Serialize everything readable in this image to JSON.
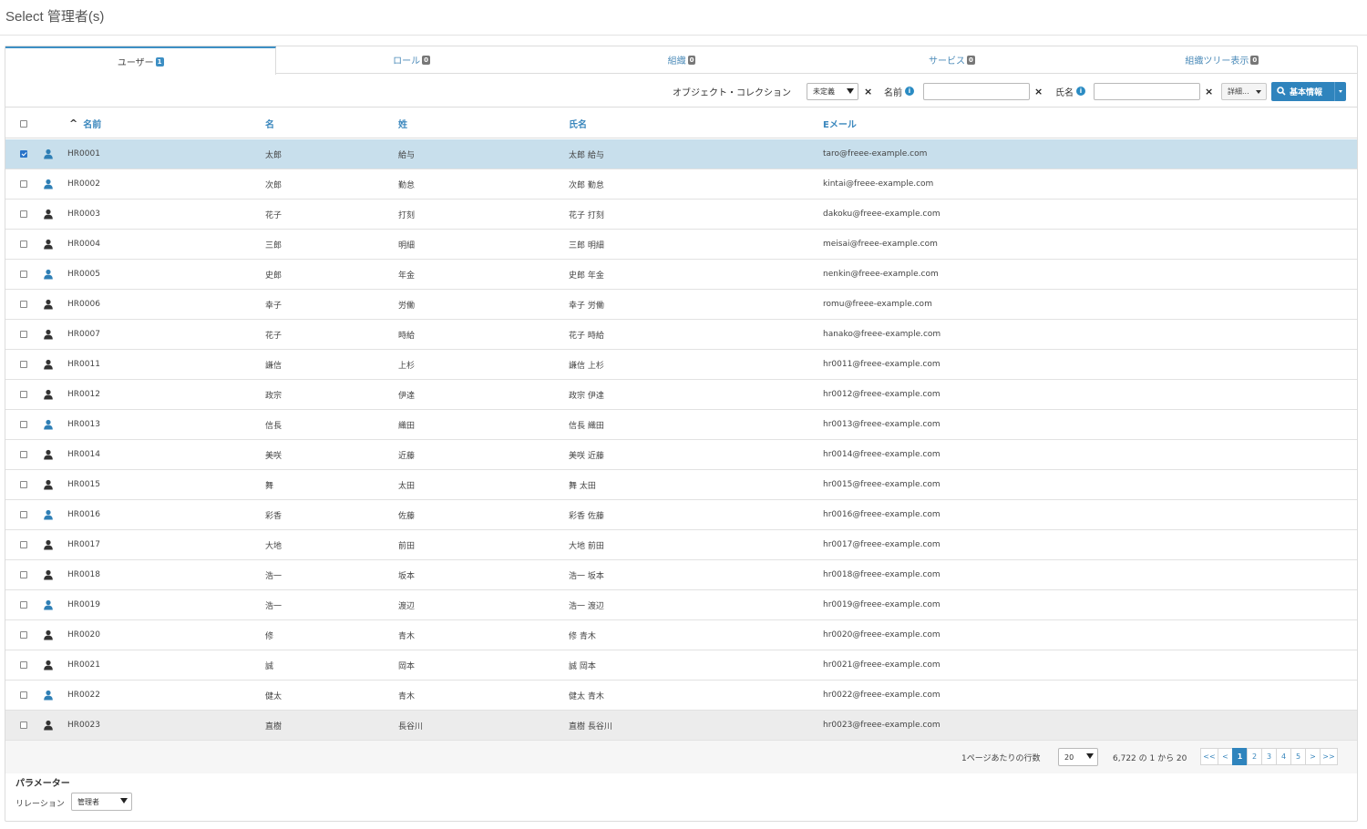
{
  "title": "Select 管理者(s)",
  "tabs": [
    {
      "label": "ユーザー",
      "badge": "1"
    },
    {
      "label": "ロール",
      "badge": "0"
    },
    {
      "label": "組織",
      "badge": "0"
    },
    {
      "label": "サービス",
      "badge": "0"
    },
    {
      "label": "組織ツリー表示",
      "badge": "0"
    }
  ],
  "filters": {
    "object_collection_label": "オブジェクト・コレクション",
    "object_collection_value": "未定義",
    "name_label": "名前",
    "name_value": "",
    "fullname_label": "氏名",
    "fullname_value": "",
    "clear_glyph": "×",
    "info_glyph": "i",
    "detail_button": "詳細...",
    "search_button": "基本情報"
  },
  "columns": {
    "sort_glyph": "^",
    "name": "名前",
    "first_name": "名",
    "last_name": "姓",
    "full_name": "氏名",
    "email": "Eメール"
  },
  "rows": [
    {
      "id": "HR0001",
      "first": "太郎",
      "last": "給与",
      "full": "太郎 給与",
      "email": "taro@freee-example.com",
      "checked": true,
      "icon_color": "#2f7fb5"
    },
    {
      "id": "HR0002",
      "first": "次郎",
      "last": "勤怠",
      "full": "次郎 勤怠",
      "email": "kintai@freee-example.com",
      "checked": false,
      "icon_color": "#2f7fb5"
    },
    {
      "id": "HR0003",
      "first": "花子",
      "last": "打刻",
      "full": "花子 打刻",
      "email": "dakoku@freee-example.com",
      "checked": false,
      "icon_color": "#333333"
    },
    {
      "id": "HR0004",
      "first": "三郎",
      "last": "明細",
      "full": "三郎 明細",
      "email": "meisai@freee-example.com",
      "checked": false,
      "icon_color": "#333333"
    },
    {
      "id": "HR0005",
      "first": "史郎",
      "last": "年金",
      "full": "史郎 年金",
      "email": "nenkin@freee-example.com",
      "checked": false,
      "icon_color": "#2f7fb5"
    },
    {
      "id": "HR0006",
      "first": "幸子",
      "last": "労働",
      "full": "幸子 労働",
      "email": "romu@freee-example.com",
      "checked": false,
      "icon_color": "#333333"
    },
    {
      "id": "HR0007",
      "first": "花子",
      "last": "時給",
      "full": "花子 時給",
      "email": "hanako@freee-example.com",
      "checked": false,
      "icon_color": "#333333"
    },
    {
      "id": "HR0011",
      "first": "謙信",
      "last": "上杉",
      "full": "謙信 上杉",
      "email": "hr0011@freee-example.com",
      "checked": false,
      "icon_color": "#333333"
    },
    {
      "id": "HR0012",
      "first": "政宗",
      "last": "伊達",
      "full": "政宗 伊達",
      "email": "hr0012@freee-example.com",
      "checked": false,
      "icon_color": "#333333"
    },
    {
      "id": "HR0013",
      "first": "信長",
      "last": "織田",
      "full": "信長 織田",
      "email": "hr0013@freee-example.com",
      "checked": false,
      "icon_color": "#2f7fb5"
    },
    {
      "id": "HR0014",
      "first": "美咲",
      "last": "近藤",
      "full": "美咲 近藤",
      "email": "hr0014@freee-example.com",
      "checked": false,
      "icon_color": "#333333"
    },
    {
      "id": "HR0015",
      "first": "舞",
      "last": "太田",
      "full": "舞 太田",
      "email": "hr0015@freee-example.com",
      "checked": false,
      "icon_color": "#333333"
    },
    {
      "id": "HR0016",
      "first": "彩香",
      "last": "佐藤",
      "full": "彩香 佐藤",
      "email": "hr0016@freee-example.com",
      "checked": false,
      "icon_color": "#2f7fb5"
    },
    {
      "id": "HR0017",
      "first": "大地",
      "last": "前田",
      "full": "大地 前田",
      "email": "hr0017@freee-example.com",
      "checked": false,
      "icon_color": "#333333"
    },
    {
      "id": "HR0018",
      "first": "浩一",
      "last": "坂本",
      "full": "浩一 坂本",
      "email": "hr0018@freee-example.com",
      "checked": false,
      "icon_color": "#333333"
    },
    {
      "id": "HR0019",
      "first": "浩一",
      "last": "渡辺",
      "full": "浩一 渡辺",
      "email": "hr0019@freee-example.com",
      "checked": false,
      "icon_color": "#2f7fb5"
    },
    {
      "id": "HR0020",
      "first": "修",
      "last": "青木",
      "full": "修 青木",
      "email": "hr0020@freee-example.com",
      "checked": false,
      "icon_color": "#333333"
    },
    {
      "id": "HR0021",
      "first": "誠",
      "last": "岡本",
      "full": "誠 岡本",
      "email": "hr0021@freee-example.com",
      "checked": false,
      "icon_color": "#333333"
    },
    {
      "id": "HR0022",
      "first": "健太",
      "last": "青木",
      "full": "健太 青木",
      "email": "hr0022@freee-example.com",
      "checked": false,
      "icon_color": "#2f7fb5"
    },
    {
      "id": "HR0023",
      "first": "直樹",
      "last": "長谷川",
      "full": "直樹 長谷川",
      "email": "hr0023@freee-example.com",
      "checked": false,
      "icon_color": "#333333"
    }
  ],
  "footer": {
    "rows_per_page_label": "1ページあたりの行数",
    "rows_per_page_value": "20",
    "range_text": "6,722 の 1 から 20",
    "pager": [
      "<<",
      "<",
      "1",
      "2",
      "3",
      "4",
      "5",
      ">",
      ">>"
    ],
    "current_page": "1"
  },
  "params": {
    "title": "パラメーター",
    "relation_label": "リレーション",
    "relation_value": "管理者"
  }
}
